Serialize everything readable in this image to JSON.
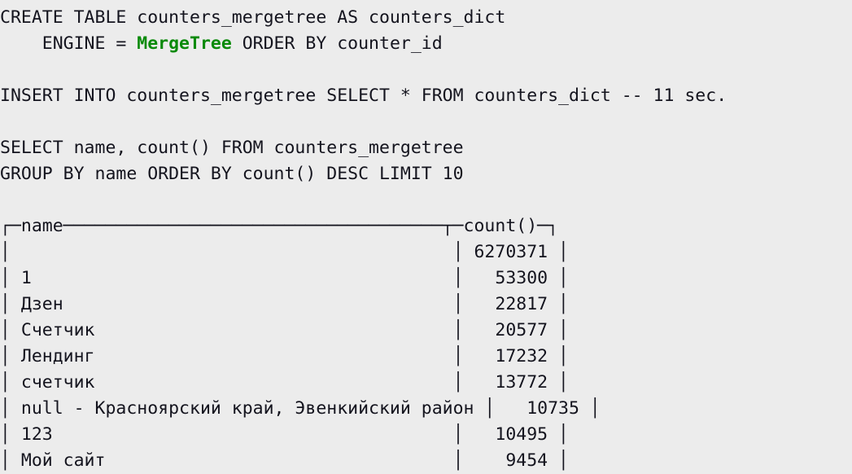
{
  "terminal": {
    "background_color": "#ececec",
    "foreground_color": "#14141e",
    "keyword_color": "#0a8a0a",
    "font_size_px": 21.5,
    "line_height_px": 32
  },
  "sql": {
    "statements": [
      {
        "id": "create-table",
        "lines": [
          {
            "segments": [
              {
                "text": "CREATE TABLE counters_mergetree AS counters_dict",
                "style": "plain"
              }
            ]
          },
          {
            "segments": [
              {
                "text": "    ENGINE = ",
                "style": "plain"
              },
              {
                "text": "MergeTree",
                "style": "keyword"
              },
              {
                "text": " ORDER BY counter_id",
                "style": "plain"
              }
            ]
          }
        ]
      },
      {
        "id": "insert-into",
        "lines": [
          {
            "segments": [
              {
                "text": "INSERT INTO counters_mergetree SELECT * FROM counters_dict -- 11 sec.",
                "style": "plain"
              }
            ]
          }
        ]
      },
      {
        "id": "select-group-by",
        "lines": [
          {
            "segments": [
              {
                "text": "SELECT name, count() FROM counters_mergetree",
                "style": "plain"
              }
            ]
          },
          {
            "segments": [
              {
                "text": "GROUP BY name ORDER BY count() DESC LIMIT 10",
                "style": "plain"
              }
            ]
          }
        ]
      }
    ],
    "comment_text": "-- 11 sec."
  },
  "result_table": {
    "columns": [
      {
        "name": "name",
        "align": "left",
        "width_chars": 42
      },
      {
        "name": "count()",
        "align": "right",
        "width_chars": 8
      }
    ],
    "rows": [
      {
        "name": "",
        "count": "6270371"
      },
      {
        "name": "1",
        "count": "53300"
      },
      {
        "name": "Дзен",
        "count": "22817"
      },
      {
        "name": "Счетчик",
        "count": "20577"
      },
      {
        "name": "Лендинг",
        "count": "17232"
      },
      {
        "name": "счетчик",
        "count": "13772"
      },
      {
        "name": "null - Красноярский край, Эвенкийский район",
        "count": "10735"
      },
      {
        "name": "123",
        "count": "10495"
      },
      {
        "name": "Мой сайт",
        "count": "9454"
      }
    ],
    "border_chars": {
      "top_left": "┌",
      "top_right": "┐",
      "top_tee": "┬",
      "horizontal": "─",
      "vertical": "│"
    },
    "rendered_header": "┌─name────────────────────────────────────┬─count()─┐",
    "rendered_rows": [
      "│                                          │ 6270371 │",
      "│ 1                                        │   53300 │",
      "│ Дзен                                     │   22817 │",
      "│ Счетчик                                  │   20577 │",
      "│ Лендинг                                  │   17232 │",
      "│ счетчик                                  │   13772 │",
      "│ null - Красноярский край, Эвенкийский район │   10735 │",
      "│ 123                                      │   10495 │",
      "│ Мой сайт                                 │    9454 │"
    ]
  }
}
